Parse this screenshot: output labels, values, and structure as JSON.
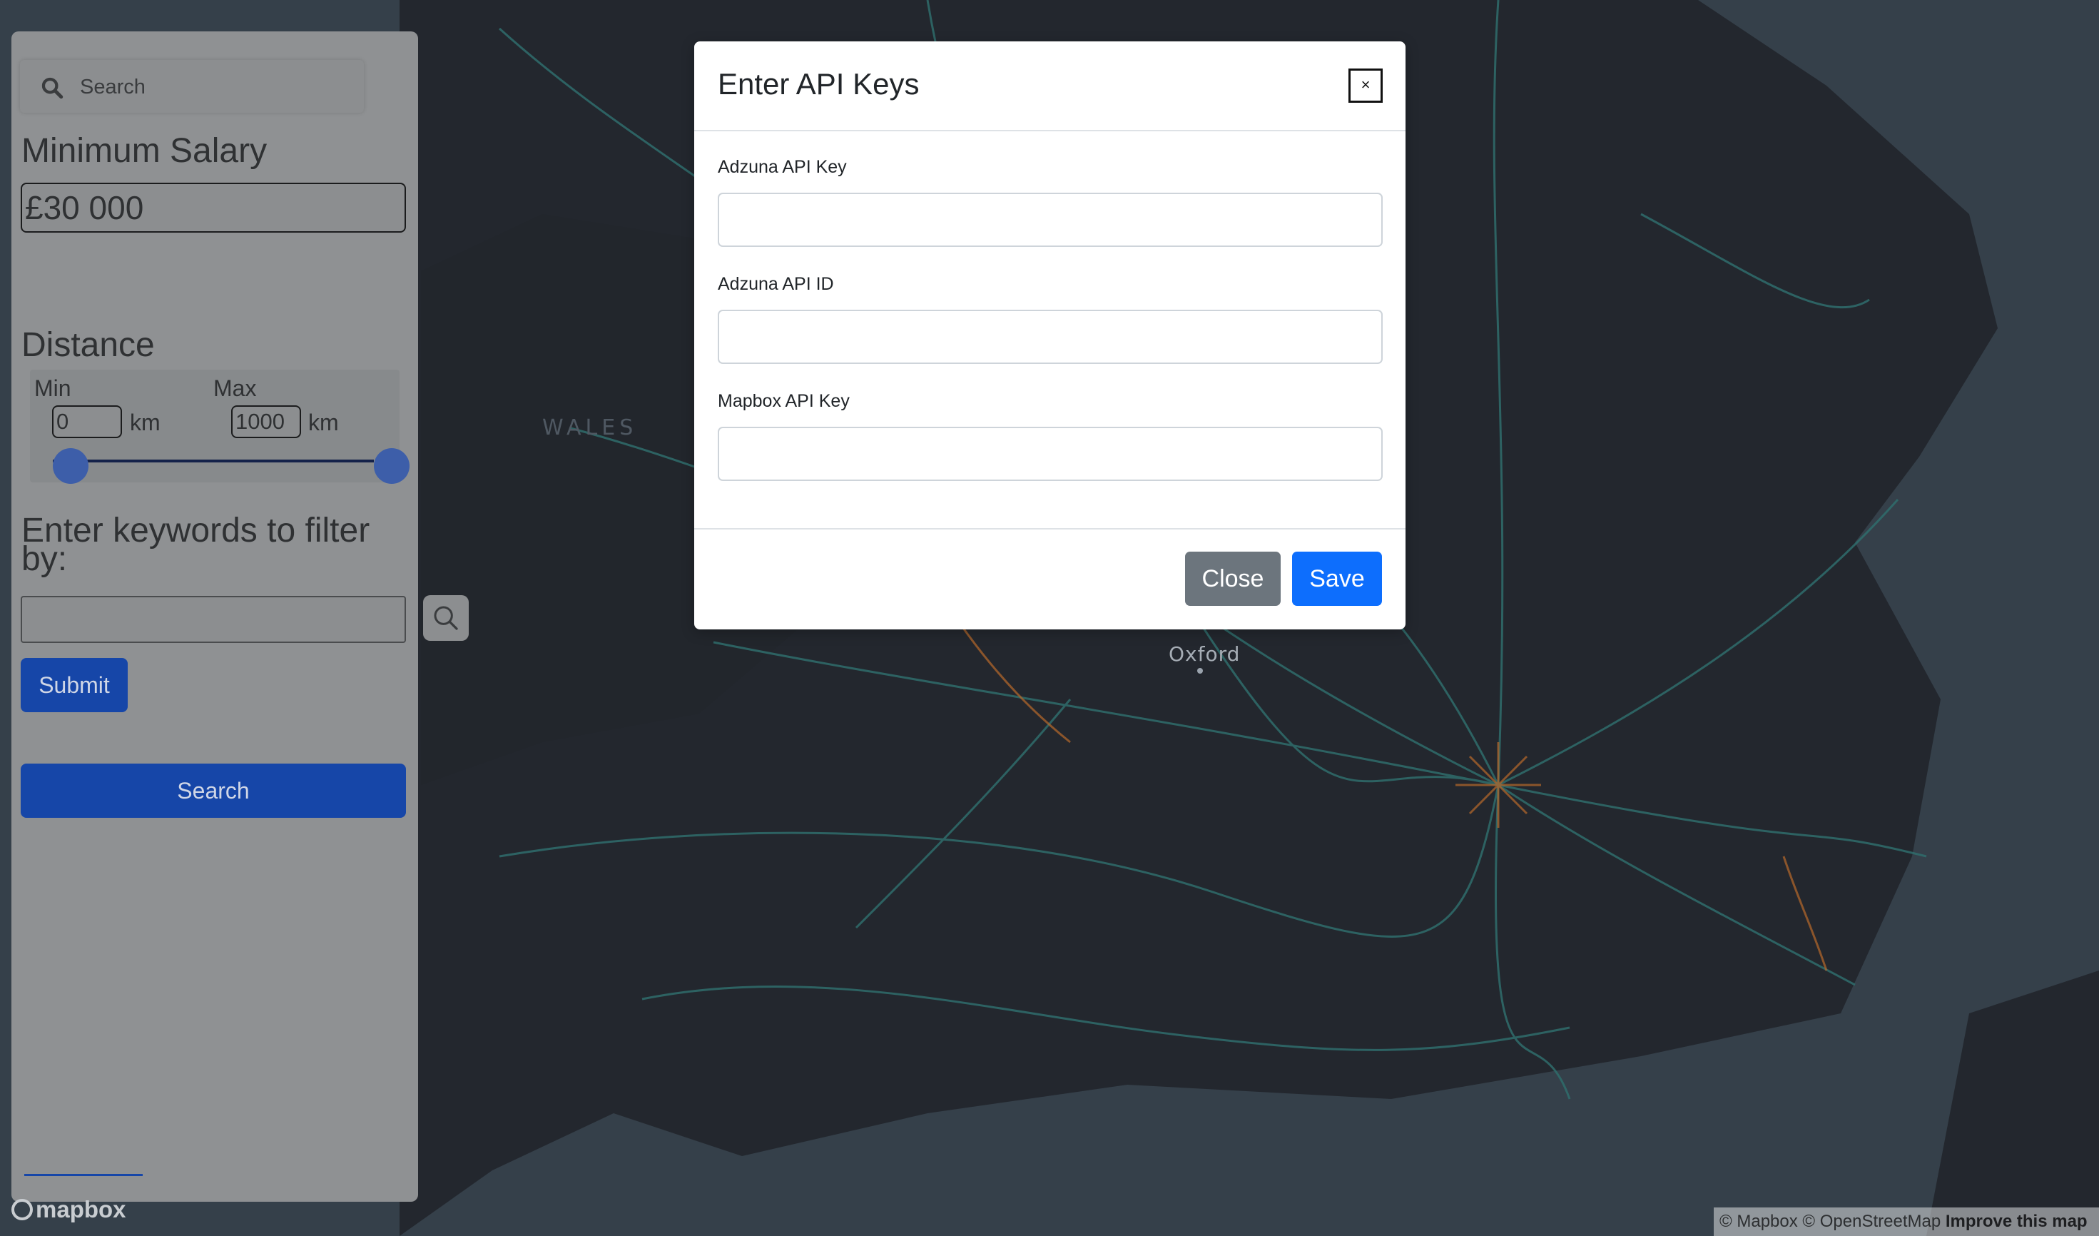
{
  "sidebar": {
    "search_placeholder": "Search",
    "min_salary_heading": "Minimum Salary",
    "min_salary_value": "£30 000",
    "distance_heading": "Distance",
    "distance_min_label": "Min",
    "distance_max_label": "Max",
    "distance_min_value": "0",
    "distance_max_value": "1000",
    "distance_unit": "km",
    "distance_range": {
      "min": 0,
      "max": 1000
    },
    "keywords_heading": "Enter keywords to filter by:",
    "keywords_value": "",
    "submit_label": "Submit",
    "search_label": "Search"
  },
  "map": {
    "city_labels": [
      "Oxford"
    ],
    "region_labels": [
      "WALES"
    ],
    "attribution_text": "© Mapbox © OpenStreetMap",
    "improve_link": "Improve this map",
    "logo_text": "mapbox"
  },
  "modal": {
    "title": "Enter API Keys",
    "close_x": "×",
    "fields": [
      {
        "label": "Adzuna API Key",
        "value": ""
      },
      {
        "label": "Adzuna API ID",
        "value": ""
      },
      {
        "label": "Mapbox API Key",
        "value": ""
      }
    ],
    "close_label": "Close",
    "save_label": "Save"
  },
  "colors": {
    "primary": "#0d6efd",
    "secondary": "#6c757d",
    "map_background": "#2c323b",
    "sidebar_button": "#1646a8"
  },
  "icons": [
    "search-icon",
    "magnifier-icon",
    "close-icon",
    "mapbox-logo-icon"
  ]
}
